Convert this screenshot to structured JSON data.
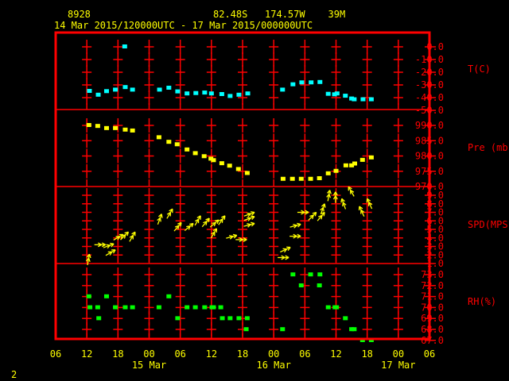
{
  "header": {
    "station": "8928",
    "location": "82.48S   174.57W    39M",
    "period": "14 Mar 2015/120000UTC - 17 Mar 2015/000000UTC"
  },
  "footer": {
    "page": "2"
  },
  "colors": {
    "frame": "#ff0000",
    "temperature": "#00ffff",
    "pressure": "#ffff00",
    "wind": "#ffff00",
    "rh": "#00ff00",
    "text": "#ffff00"
  },
  "chart_data": {
    "type": "scatter",
    "x_unit": "hours since 14 Mar 06 UTC",
    "xlim": [
      0,
      72
    ],
    "x_ticks": [
      {
        "h": 0,
        "label": "06"
      },
      {
        "h": 6,
        "label": "12"
      },
      {
        "h": 12,
        "label": "18"
      },
      {
        "h": 18,
        "label": "00"
      },
      {
        "h": 24,
        "label": "06"
      },
      {
        "h": 30,
        "label": "12"
      },
      {
        "h": 36,
        "label": "18"
      },
      {
        "h": 42,
        "label": "00"
      },
      {
        "h": 48,
        "label": "06"
      },
      {
        "h": 54,
        "label": "12"
      },
      {
        "h": 60,
        "label": "18"
      },
      {
        "h": 66,
        "label": "00"
      },
      {
        "h": 72,
        "label": "06"
      }
    ],
    "date_labels": [
      {
        "h": 18,
        "label": "15 Mar"
      },
      {
        "h": 42,
        "label": "16 Mar"
      },
      {
        "h": 66,
        "label": "17 Mar"
      }
    ],
    "panels": [
      {
        "name": "temperature",
        "ylabel": "T(C)",
        "ylim": [
          -50,
          0
        ],
        "ticks": [
          "0.0",
          "-10.0",
          "-20.0",
          "-30.0",
          "-40.0",
          "-50.0"
        ],
        "points": [
          [
            6.5,
            -35
          ],
          [
            8.2,
            -38
          ],
          [
            9.8,
            -35.2
          ],
          [
            11.5,
            -34
          ],
          [
            13.4,
            -32
          ],
          [
            13.3,
            0
          ],
          [
            14.8,
            -34
          ],
          [
            20,
            -34
          ],
          [
            21.8,
            -32.5
          ],
          [
            23.5,
            -35.4
          ],
          [
            25.3,
            -37
          ],
          [
            27,
            -36.7
          ],
          [
            28.7,
            -36.3
          ],
          [
            30,
            -37
          ],
          [
            32,
            -37.5
          ],
          [
            33.6,
            -39
          ],
          [
            35.3,
            -38
          ],
          [
            37,
            -37
          ],
          [
            43.7,
            -34
          ],
          [
            45.7,
            -29.8
          ],
          [
            47.4,
            -28.3
          ],
          [
            49.2,
            -28.3
          ],
          [
            50.9,
            -28
          ],
          [
            52.5,
            -37.3
          ],
          [
            53.7,
            -37.7
          ],
          [
            54.2,
            -37
          ],
          [
            55.8,
            -38.8
          ],
          [
            57,
            -41
          ],
          [
            57.5,
            -41.6
          ],
          [
            59.2,
            -41.6
          ],
          [
            60.8,
            -41.6
          ]
        ]
      },
      {
        "name": "pressure",
        "ylabel": "Pre (mb)",
        "ylim": [
          970,
          990
        ],
        "ticks": [
          "990.0",
          "985.0",
          "980.0",
          "975.0",
          "970.0"
        ],
        "points": [
          [
            6.4,
            990
          ],
          [
            8.1,
            989.7
          ],
          [
            9.8,
            989
          ],
          [
            11.5,
            989
          ],
          [
            13.4,
            988.5
          ],
          [
            14.8,
            988.2
          ],
          [
            19.9,
            986
          ],
          [
            21.8,
            984.5
          ],
          [
            23.4,
            983.7
          ],
          [
            25.3,
            982
          ],
          [
            26.9,
            980.8
          ],
          [
            28.6,
            979.8
          ],
          [
            29.9,
            979
          ],
          [
            30.4,
            978.5
          ],
          [
            32,
            977.5
          ],
          [
            33.5,
            976.7
          ],
          [
            35.2,
            975.6
          ],
          [
            36.9,
            974.3
          ],
          [
            43.8,
            972.4
          ],
          [
            45.6,
            972.4
          ],
          [
            47.3,
            972.4
          ],
          [
            49.1,
            972.4
          ],
          [
            50.8,
            972.6
          ],
          [
            52.5,
            974.2
          ],
          [
            54,
            975
          ],
          [
            55.9,
            976.8
          ],
          [
            57,
            976.8
          ],
          [
            57.6,
            977.4
          ],
          [
            59.1,
            978.6
          ],
          [
            60.8,
            979.4
          ]
        ]
      },
      {
        "name": "wind",
        "ylabel": "SPD(MPS)",
        "ylim": [
          1,
          9
        ],
        "ticks": [
          "9.0",
          "8.0",
          "7.0",
          "6.0",
          "5.0",
          "4.0",
          "3.0",
          "2.0",
          "1.0"
        ],
        "arrows": [
          [
            6.5,
            2.1,
            80
          ],
          [
            9.6,
            3.2,
            0
          ],
          [
            11.2,
            3.3,
            20
          ],
          [
            11.5,
            2.6,
            30
          ],
          [
            13,
            4.4,
            30
          ],
          [
            14,
            4.7,
            45
          ],
          [
            15.3,
            4.7,
            60
          ],
          [
            20.4,
            6.8,
            70
          ],
          [
            22.5,
            7.4,
            60
          ],
          [
            24.2,
            5.8,
            50
          ],
          [
            26.5,
            5.7,
            40
          ],
          [
            27.9,
            6.6,
            60
          ],
          [
            29.6,
            6.3,
            50
          ],
          [
            31.4,
            6.1,
            40
          ],
          [
            32.6,
            6.6,
            55
          ],
          [
            31,
            5.1,
            60
          ],
          [
            34.9,
            4.3,
            15
          ],
          [
            36.8,
            3.8,
            0
          ],
          [
            38.3,
            7,
            20
          ],
          [
            38.3,
            6.5,
            20
          ],
          [
            38.3,
            5.7,
            15
          ],
          [
            44.9,
            1.7,
            0
          ],
          [
            45.2,
            2.9,
            25
          ],
          [
            47.2,
            4.2,
            0
          ],
          [
            47.2,
            5.6,
            15
          ],
          [
            48.7,
            7,
            0
          ],
          [
            50.2,
            7,
            45
          ],
          [
            51.8,
            7,
            50
          ],
          [
            51.8,
            8,
            70
          ],
          [
            52.8,
            9.6,
            80
          ],
          [
            53.9,
            9.4,
            90
          ],
          [
            55.1,
            8.6,
            110
          ],
          [
            56.4,
            10,
            120
          ],
          [
            58.5,
            7.7,
            115
          ],
          [
            60,
            8.6,
            115
          ]
        ]
      },
      {
        "name": "rh",
        "ylabel": "RH(%)",
        "ylim": [
          67,
          73
        ],
        "ticks": [
          "73.0",
          "72.0",
          "71.0",
          "70.0",
          "69.0",
          "68.0",
          "67.0"
        ],
        "points": [
          [
            6.4,
            71
          ],
          [
            6.6,
            70
          ],
          [
            8.1,
            70
          ],
          [
            8.3,
            69
          ],
          [
            9.8,
            71
          ],
          [
            11.5,
            70
          ],
          [
            13.4,
            70
          ],
          [
            14.8,
            70
          ],
          [
            19.9,
            70
          ],
          [
            21.8,
            71
          ],
          [
            23.5,
            69
          ],
          [
            25.3,
            70
          ],
          [
            26.9,
            70
          ],
          [
            28.7,
            70
          ],
          [
            30.1,
            70
          ],
          [
            30.4,
            70
          ],
          [
            31.8,
            70
          ],
          [
            32.1,
            69
          ],
          [
            33.6,
            69
          ],
          [
            35.3,
            69
          ],
          [
            36.9,
            69
          ],
          [
            36.7,
            68
          ],
          [
            43.7,
            68
          ],
          [
            45.7,
            73
          ],
          [
            47.3,
            72
          ],
          [
            49.1,
            73
          ],
          [
            50.8,
            72
          ],
          [
            50.9,
            73
          ],
          [
            52.5,
            70
          ],
          [
            53.8,
            70
          ],
          [
            54.1,
            70
          ],
          [
            55.8,
            69
          ],
          [
            57,
            68
          ],
          [
            57.5,
            68
          ],
          [
            59.1,
            67
          ],
          [
            60.8,
            67
          ]
        ]
      }
    ]
  }
}
